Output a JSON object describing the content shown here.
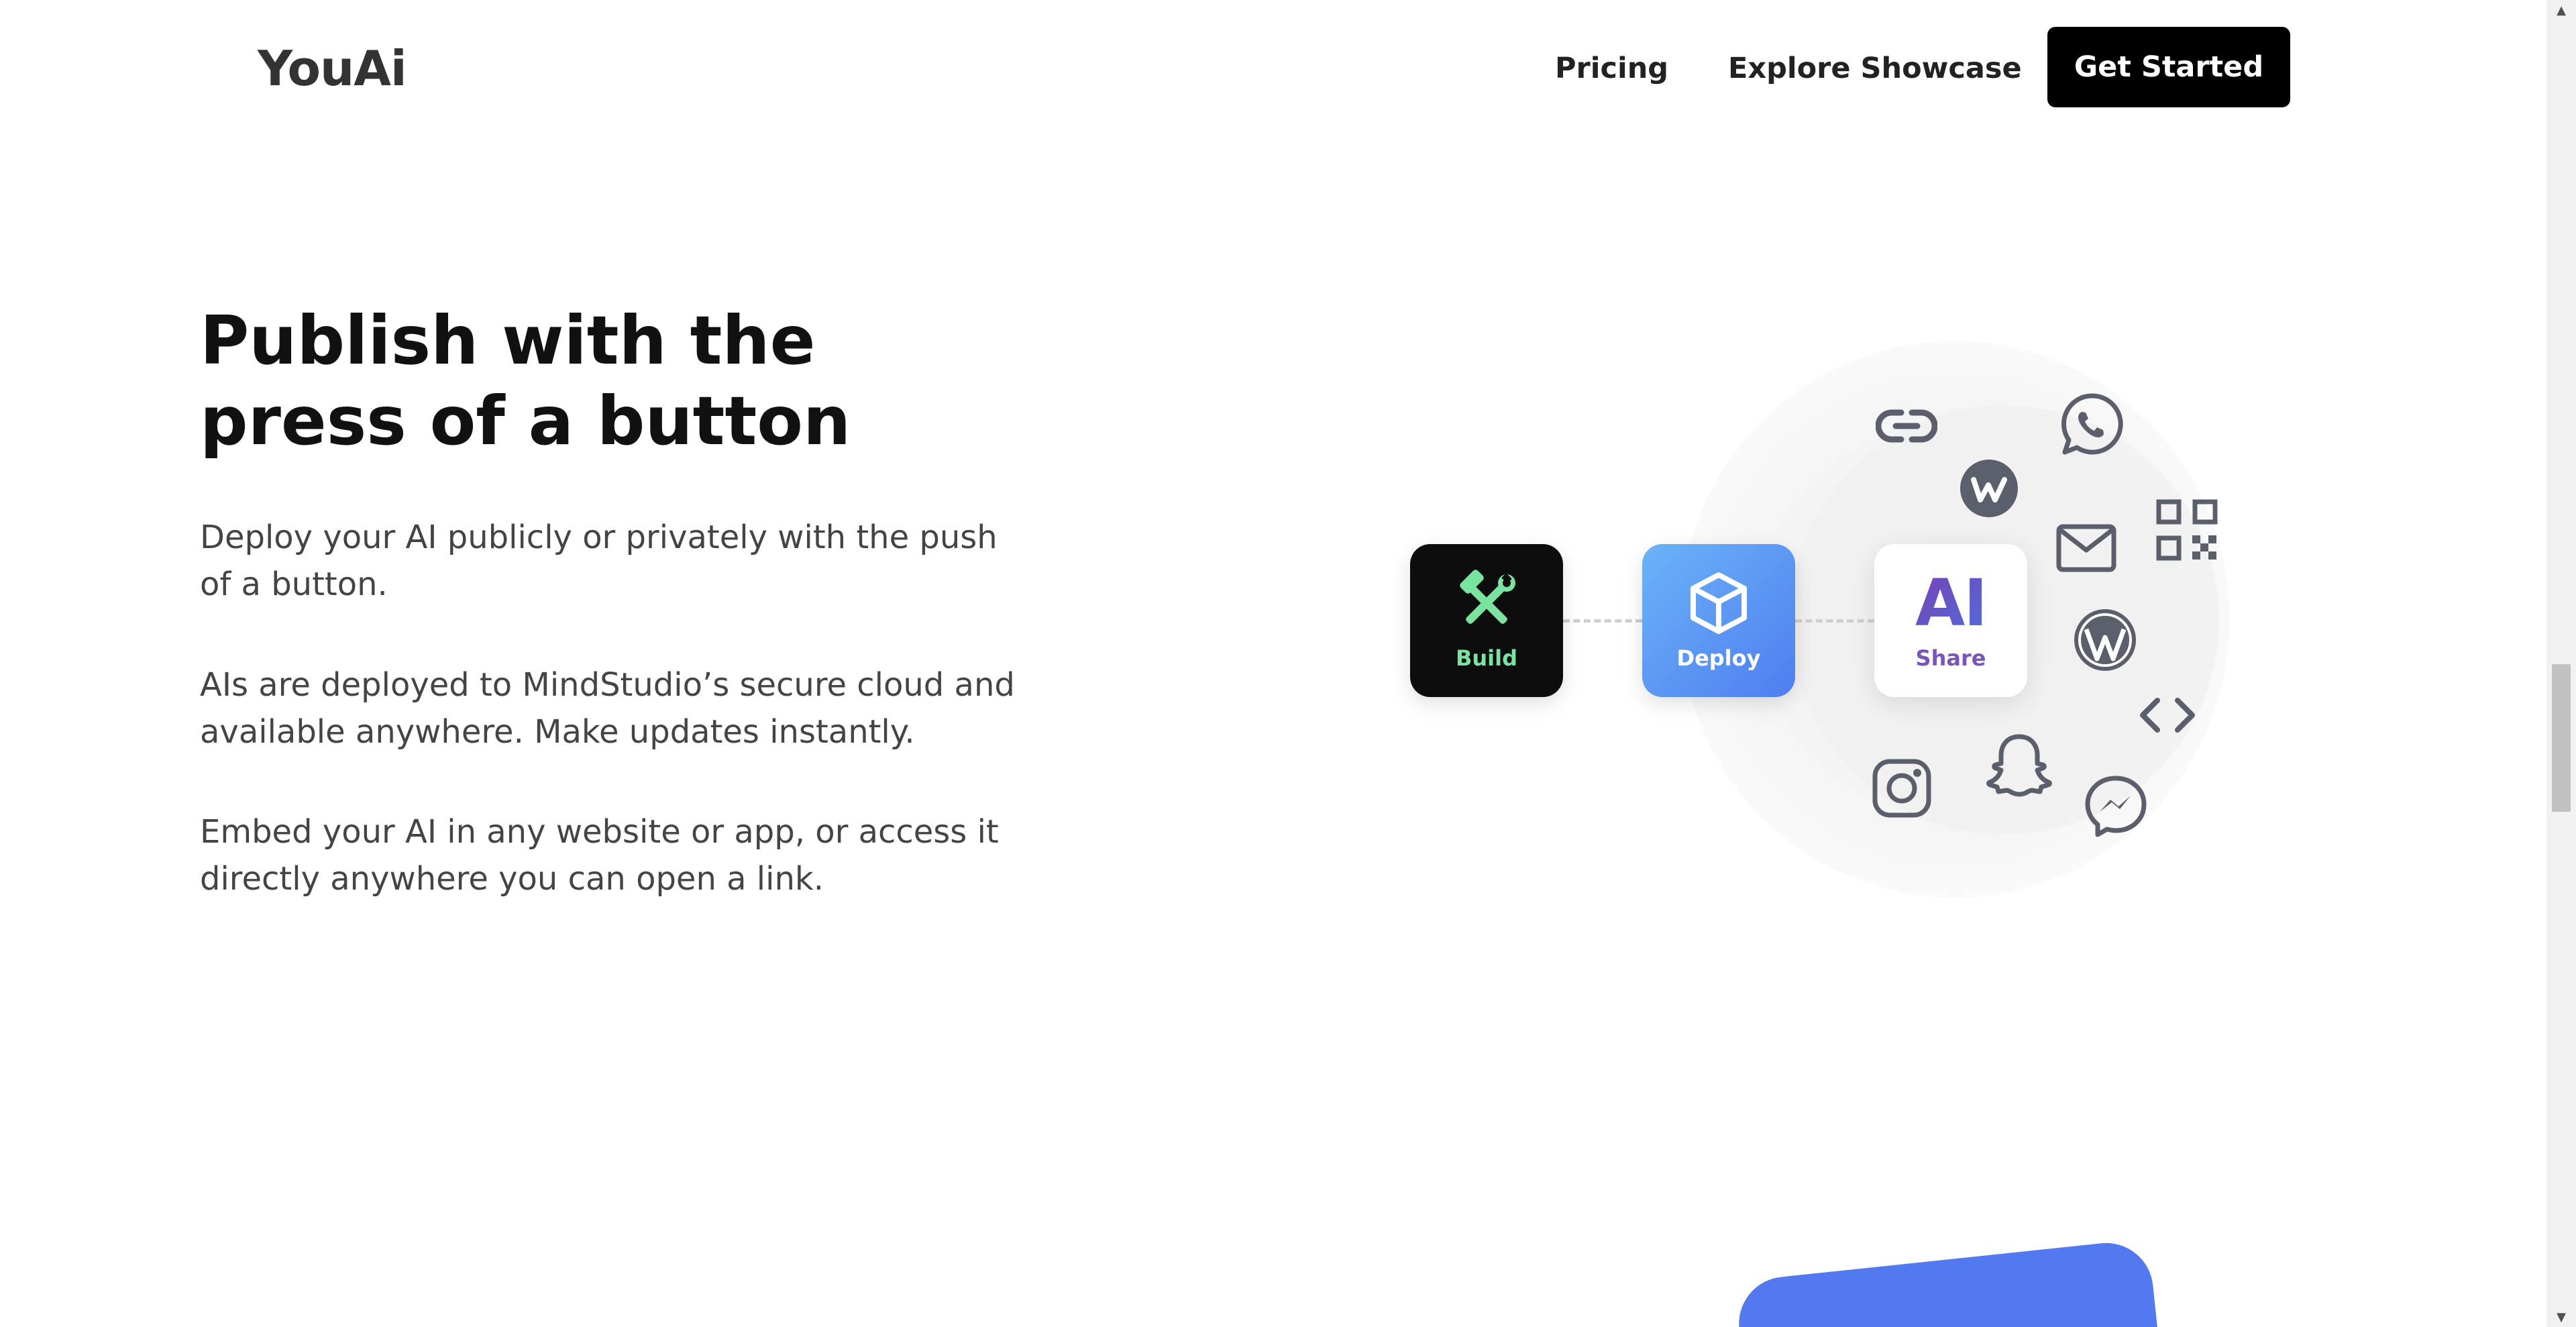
{
  "header": {
    "brand": "YouAi",
    "nav": {
      "pricing": "Pricing",
      "showcase": "Explore Showcase"
    },
    "cta": "Get Started"
  },
  "hero": {
    "headline_line1": "Publish with the",
    "headline_line2": "press of a button",
    "paragraphs": [
      "Deploy your AI publicly or privately with the push of a button.",
      "AIs are deployed to MindStudio’s secure cloud and available anywhere. Make updates instantly.",
      "Embed your AI in any website or app, or access it directly anywhere you can open a link."
    ]
  },
  "flow": {
    "build": {
      "label": "Build",
      "icon": "tools-icon"
    },
    "deploy": {
      "label": "Deploy",
      "icon": "box-icon"
    },
    "share": {
      "label": "Share",
      "mark": "AI"
    }
  },
  "channels": [
    "link-icon",
    "whatsapp-icon",
    "webflow-icon",
    "email-icon",
    "qr-code-icon",
    "wordpress-icon",
    "code-embed-icon",
    "instagram-icon",
    "snapchat-icon",
    "messenger-icon"
  ],
  "colors": {
    "build_tile": "#0d0d0d",
    "build_label": "#7be3a0",
    "deploy_gradient_start": "#6ab3f8",
    "deploy_gradient_end": "#4f7ef0",
    "share_mark_gradient_start": "#7a3fb6",
    "share_mark_gradient_end": "#4f6fd8",
    "icon_gray": "#5a5f6b",
    "accent_blue": "#5379f0"
  }
}
